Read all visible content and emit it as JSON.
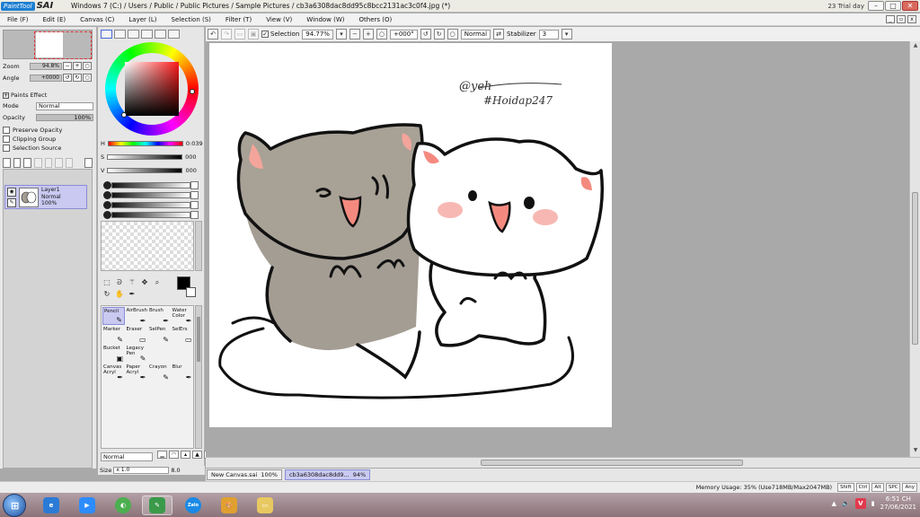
{
  "app": {
    "logo_text_1": "PaintTool",
    "logo_text_2": "SAI",
    "title": "Windows 7 (C:) / Users / Public / Public Pictures / Sample Pictures / cb3a6308dac8dd95c8bcc2131ac3c0f4.jpg (*)",
    "trial": "23 Trial day",
    "win_min": "–",
    "win_max": "□",
    "win_close": "✕"
  },
  "menu": [
    "File (F)",
    "Edit (E)",
    "Canvas (C)",
    "Layer (L)",
    "Selection (S)",
    "Filter (T)",
    "View (V)",
    "Window (W)",
    "Others (O)"
  ],
  "toolbar": {
    "selection_label": "Selection",
    "zoom": "94.77%",
    "rotation": "+000°",
    "blend": "Normal",
    "stabilizer_label": "Stabilizer",
    "stabilizer_value": "3"
  },
  "navigator": {
    "zoom_label": "Zoom",
    "zoom_value": "94.8%",
    "angle_label": "Angle",
    "angle_value": "+0000",
    "paints_effect": "Paints Effect",
    "mode_label": "Mode",
    "mode_value": "Normal",
    "opacity_label": "Opacity",
    "opacity_value": "100%",
    "checks": [
      "Preserve Opacity",
      "Clipping Group",
      "Selection Source"
    ]
  },
  "layer": {
    "name": "Layer1",
    "mode": "Normal",
    "opacity": "100%"
  },
  "color": {
    "h_label": "H",
    "h_value": "0:039",
    "s_label": "S",
    "s_value": "000",
    "v_label": "V",
    "v_value": "000",
    "fg": "#000000",
    "bg": "#ffffff"
  },
  "tools": [
    {
      "label": "Pencil",
      "icon": "✎",
      "selected": true
    },
    {
      "label": "AirBrush",
      "icon": "✒"
    },
    {
      "label": "Brush",
      "icon": "✒"
    },
    {
      "label": "Water Color",
      "icon": "✒"
    },
    {
      "label": "Marker",
      "icon": "✎"
    },
    {
      "label": "Eraser",
      "icon": "▭"
    },
    {
      "label": "SelPen",
      "icon": "✎"
    },
    {
      "label": "SelErs",
      "icon": "▭"
    },
    {
      "label": "Bucket",
      "icon": "▣"
    },
    {
      "label": "Legacy Pen",
      "icon": "✎"
    },
    {
      "label": "",
      "icon": ""
    },
    {
      "label": "",
      "icon": ""
    },
    {
      "label": "Canvas Acryl",
      "icon": "✒"
    },
    {
      "label": "Paper Acryl",
      "icon": "✒"
    },
    {
      "label": "Crayon",
      "icon": "✎"
    },
    {
      "label": "Blur",
      "icon": "✒"
    }
  ],
  "brush": {
    "mode": "Normal",
    "size_label": "Size",
    "size_mult": "x 1.0",
    "size_value": "8.0",
    "min_size_label": "Min Size",
    "min_size_value": "12%"
  },
  "canvas": {
    "signature_1": "@yeh",
    "signature_2": "#Hoidap247"
  },
  "doc_tabs": [
    {
      "name": "New Canvas.sai",
      "zoom": "100%"
    },
    {
      "name": "cb3a6308dac8dd9...",
      "zoom": "94%"
    }
  ],
  "status": {
    "memory": "Memory Usage: 35% (Use718MB/Max2047MB)",
    "keys": [
      "Shift",
      "Ctrl",
      "Alt",
      "SPC",
      "Any"
    ]
  },
  "taskbar": {
    "clock_time": "6:51 CH",
    "clock_date": "27/06/2021",
    "apps": [
      "ie",
      "zoom",
      "coccoc",
      "paint-tool-sai",
      "zalo",
      "paint",
      "folder"
    ],
    "vpn": "V"
  }
}
